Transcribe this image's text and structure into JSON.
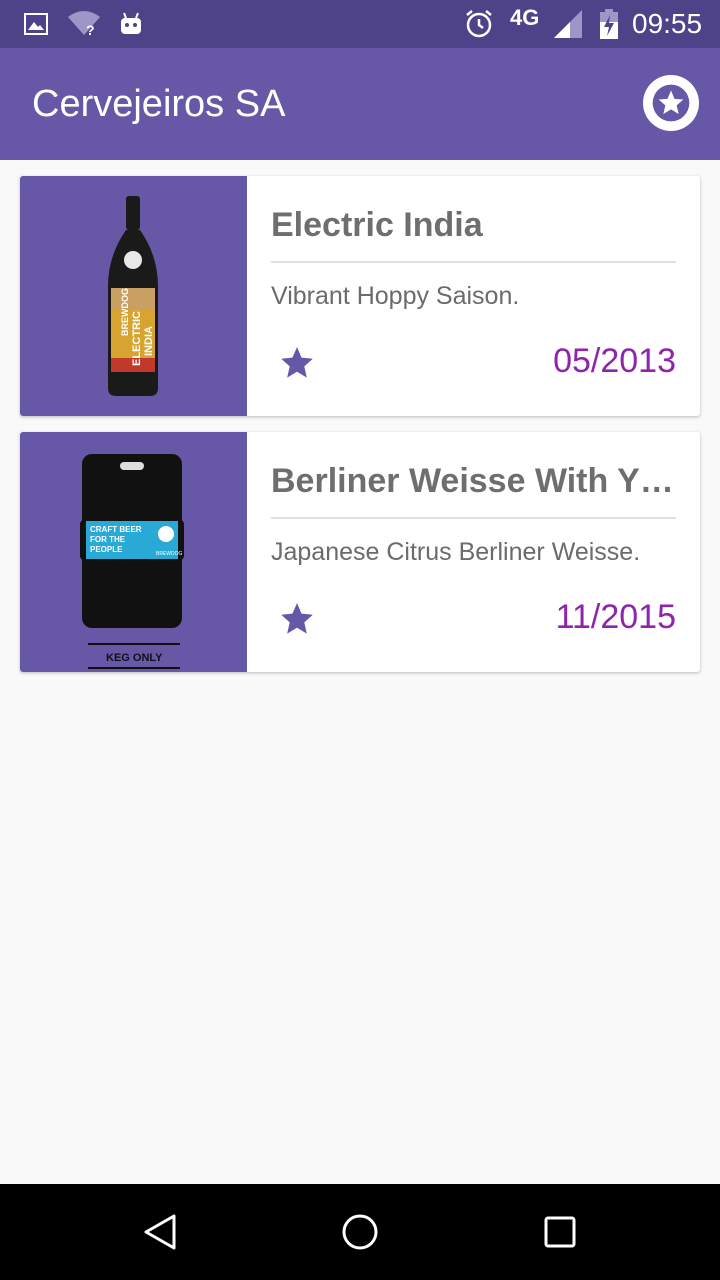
{
  "status_bar": {
    "network": "4G",
    "time": "09:55"
  },
  "app_bar": {
    "title": "Cervejeiros SA",
    "favorites_icon": "star-circle-icon"
  },
  "beers": [
    {
      "name": "Electric India",
      "tagline": "Vibrant Hoppy Saison.",
      "first_brewed": "05/2013",
      "image": "bottle",
      "favorite_icon": "star-icon"
    },
    {
      "name": "Berliner Weisse With Y…",
      "tagline": "Japanese Citrus Berliner Weisse.",
      "first_brewed": "11/2015",
      "image": "keg",
      "favorite_icon": "star-icon"
    }
  ],
  "bottle_label_text": [
    "BREWDOG",
    "ELECTRIC",
    "INDIA"
  ],
  "keg_label_text": [
    "CRAFT BEER",
    "FOR THE",
    "PEOPLE",
    "BREWDOG",
    "KEG ONLY"
  ],
  "colors": {
    "status_bar": "#4e4388",
    "app_bar": "#6658a6",
    "accent_date": "#8e24aa",
    "star": "#6658a6"
  }
}
